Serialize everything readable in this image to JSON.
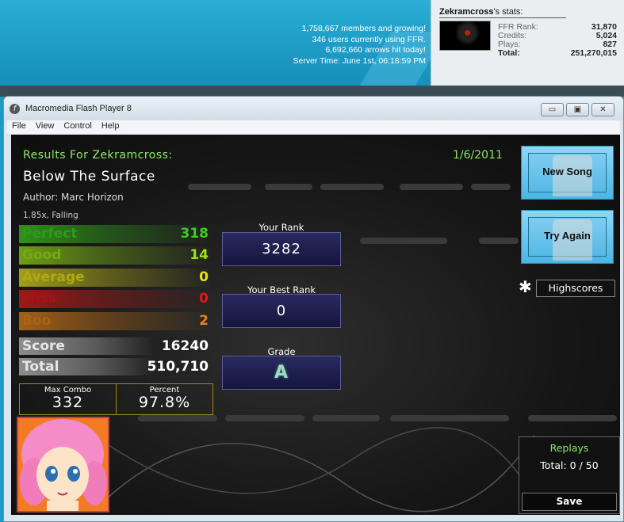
{
  "site": {
    "members": "1,758,667 members and growing!",
    "users_online": "346 users currently using FFR.",
    "arrows_hit": "6,692,660 arrows hit today!",
    "server_time": "Server Time: June 1st, 06:18:59 PM",
    "user_name": "Zekramcross",
    "user_stats_suffix": "'s stats:",
    "stats": [
      {
        "label": "FFR Rank:",
        "value": "31,870"
      },
      {
        "label": "Credits:",
        "value": "5,024"
      },
      {
        "label": "Plays:",
        "value": "827"
      },
      {
        "label": "Total:",
        "value": "251,270,015"
      }
    ]
  },
  "window": {
    "title": "Macromedia Flash Player 8",
    "menu": [
      "File",
      "View",
      "Control",
      "Help"
    ]
  },
  "results": {
    "header": "Results For Zekramcross:",
    "date": "1/6/2011",
    "song": "Below The Surface",
    "author": "Author: Marc Horizon",
    "mods": "1.85x, Falling",
    "judgements": [
      {
        "name": "Perfect",
        "value": "318",
        "color": "#3ccf1e"
      },
      {
        "name": "Good",
        "value": "14",
        "color": "#9be219"
      },
      {
        "name": "Average",
        "value": "0",
        "color": "#e8e21b"
      },
      {
        "name": "Miss",
        "value": "0",
        "color": "#e01a1a"
      },
      {
        "name": "Boo",
        "value": "2",
        "color": "#e5841a"
      }
    ],
    "score_label": "Score",
    "score": "16240",
    "total_label": "Total",
    "total": "510,710",
    "max_combo_label": "Max Combo",
    "max_combo": "332",
    "percent_label": "Percent",
    "percent": "97.8%",
    "your_rank_label": "Your Rank",
    "your_rank": "3282",
    "best_rank_label": "Your Best Rank",
    "best_rank": "0",
    "grade_label": "Grade",
    "grade": "A"
  },
  "buttons": {
    "new_song": "New Song",
    "try_again": "Try Again",
    "highscores": "Highscores"
  },
  "replays": {
    "title": "Replays",
    "total": "Total: 0 / 50",
    "save": "Save"
  }
}
